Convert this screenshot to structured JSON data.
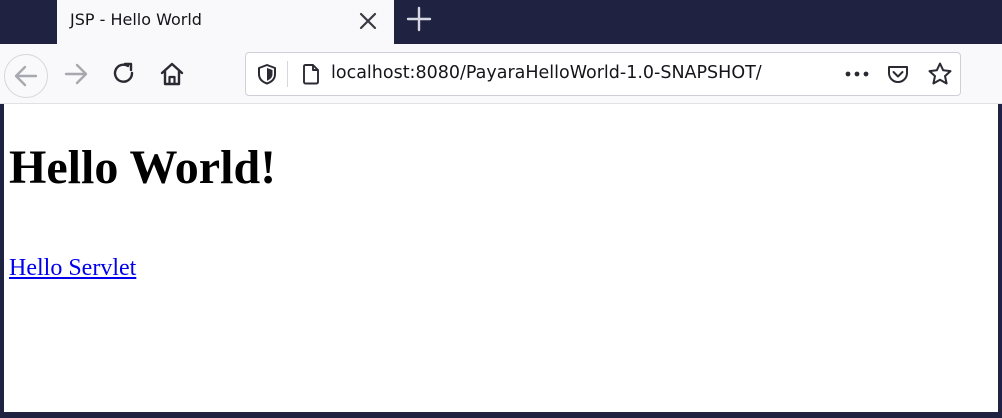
{
  "tab": {
    "title": "JSP - Hello World",
    "close_icon": "close-icon",
    "new_tab_icon": "plus-icon"
  },
  "toolbar": {
    "back_icon": "arrow-left-icon",
    "forward_icon": "arrow-right-icon",
    "reload_icon": "reload-icon",
    "home_icon": "home-icon"
  },
  "urlbar": {
    "url": "localhost:8080/PayaraHelloWorld-1.0-SNAPSHOT/",
    "tracking_icon": "shield-icon",
    "page_icon": "page-icon",
    "actions_icon": "more-icon",
    "pocket_icon": "pocket-icon",
    "bookmark_icon": "star-icon"
  },
  "page": {
    "heading": "Hello World!",
    "link": "Hello Servlet"
  },
  "colors": {
    "frame": "#1f2341",
    "toolbar": "#f9f9fb",
    "link": "#0000ee"
  }
}
